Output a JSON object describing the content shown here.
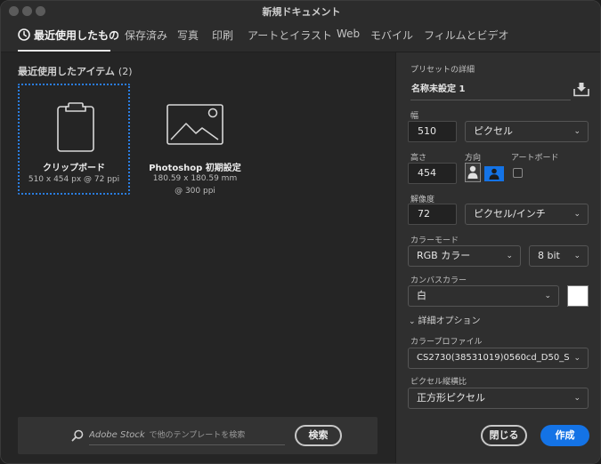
{
  "window": {
    "title": "新規ドキュメント"
  },
  "tabs": [
    {
      "label": "最近使用したもの",
      "active": true
    },
    {
      "label": "保存済み"
    },
    {
      "label": "写真"
    },
    {
      "label": "印刷"
    },
    {
      "label": "アートとイラスト"
    },
    {
      "label": "Web"
    },
    {
      "label": "モバイル"
    },
    {
      "label": "フィルムとビデオ"
    }
  ],
  "recent": {
    "heading": "最近使用したアイテム",
    "count": "(2)",
    "items": [
      {
        "name": "クリップボード",
        "meta": "510 x 454 px @ 72 ppi",
        "selected": true,
        "icon": "clipboard-icon"
      },
      {
        "name": "Photoshop 初期設定",
        "meta": "180.59 x 180.59 mm @ 300 ppi",
        "selected": false,
        "icon": "image-icon"
      }
    ]
  },
  "stock": {
    "placeholder_brand": "Adobe Stock",
    "placeholder_rest": "で他のテンプレートを検索",
    "search_button": "検索"
  },
  "preset": {
    "section_label": "プリセットの詳細",
    "name": "名称未設定 1",
    "width_label": "幅",
    "width_value": "510",
    "width_unit": "ピクセル",
    "height_label": "高さ",
    "height_value": "454",
    "orientation_label": "方向",
    "artboard_label": "アートボード",
    "resolution_label": "解像度",
    "resolution_value": "72",
    "resolution_unit": "ピクセル/インチ",
    "color_mode_label": "カラーモード",
    "color_mode_value": "RGB カラー",
    "bit_depth_value": "8 bit",
    "canvas_color_label": "カンバスカラー",
    "canvas_color_value": "白",
    "canvas_swatch": "#ffffff",
    "advanced_label": "詳細オプション",
    "color_profile_label": "カラープロファイル",
    "color_profile_value": "CS2730(38531019)0560cd_D50_S",
    "pixel_aspect_label": "ピクセル縦横比",
    "pixel_aspect_value": "正方形ピクセル"
  },
  "actions": {
    "close": "閉じる",
    "create": "作成"
  },
  "colors": {
    "accent": "#1473e6",
    "selection": "#2a7de1",
    "panel": "#2f2f2f",
    "background": "#252525"
  }
}
